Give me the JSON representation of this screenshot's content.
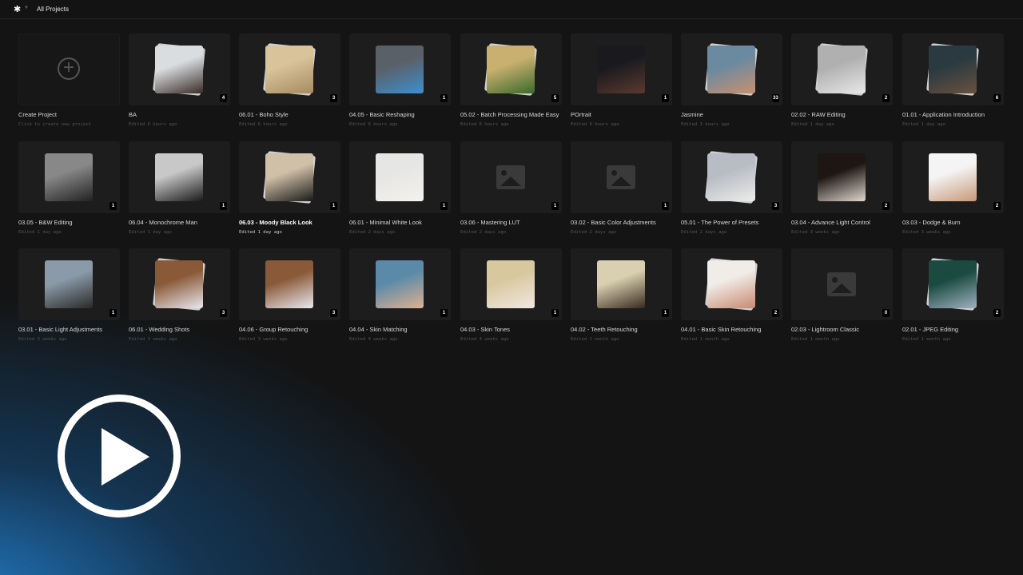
{
  "header": {
    "logo_icon": "sparkle-icon",
    "breadcrumb": "All Projects"
  },
  "create": {
    "title": "Create Project",
    "subtitle": "Click to create new project"
  },
  "projects": [
    {
      "title": "BA",
      "edited": "Edited 6 hours ago",
      "count": "4",
      "thumb": "stack",
      "colors": [
        "#d9dde0",
        "#3a2c28"
      ]
    },
    {
      "title": "06.01 - Boho Style",
      "edited": "Edited 6 hours ago",
      "count": "3",
      "thumb": "stack",
      "colors": [
        "#d8c39a",
        "#a78b60"
      ]
    },
    {
      "title": "04.05 - Basic Reshaping",
      "edited": "Edited 6 hours ago",
      "count": "1",
      "thumb": "photo",
      "colors": [
        "#5a6068",
        "#3d8fcf"
      ]
    },
    {
      "title": "05.02 - Batch Processing Made Easy",
      "edited": "Edited 6 hours ago",
      "count": "5",
      "thumb": "stack",
      "colors": [
        "#c9b070",
        "#3a6a2a"
      ]
    },
    {
      "title": "POrtrait",
      "edited": "Edited 6 hours ago",
      "count": "1",
      "thumb": "photo",
      "colors": [
        "#1a1a1e",
        "#5a3a30"
      ]
    },
    {
      "title": "Jasmine",
      "edited": "Edited 3 hours ago",
      "count": "33",
      "thumb": "stack",
      "colors": [
        "#6a8aa0",
        "#c89070"
      ]
    },
    {
      "title": "02.02 - RAW Editing",
      "edited": "Edited 1 day ago",
      "count": "2",
      "thumb": "stack",
      "colors": [
        "#b0b0b0",
        "#e8e8e8"
      ]
    },
    {
      "title": "01.01 - Application Introduction",
      "edited": "Edited 1 day ago",
      "count": "6",
      "thumb": "stack",
      "colors": [
        "#2a3a40",
        "#6a5040"
      ]
    },
    {
      "title": "03.05 - B&W Editing",
      "edited": "Edited 1 day ago",
      "count": "1",
      "thumb": "photo",
      "colors": [
        "#888",
        "#222"
      ]
    },
    {
      "title": "06.04 - Monochrome Man",
      "edited": "Edited 1 day ago",
      "count": "1",
      "thumb": "photo",
      "colors": [
        "#c8c8c8",
        "#1a1a1a"
      ]
    },
    {
      "title": "06.03 - Moody Black Look",
      "edited": "Edited 1 day ago",
      "count": "1",
      "thumb": "stack",
      "colors": [
        "#d0c0a8",
        "#1a1a1a"
      ],
      "highlight": true
    },
    {
      "title": "06.01 - Minimal White Look",
      "edited": "Edited 2 days ago",
      "count": "1",
      "thumb": "photo",
      "colors": [
        "#e6e6e4",
        "#f4f2ee"
      ]
    },
    {
      "title": "03.06 - Mastering LUT",
      "edited": "Edited 2 days ago",
      "count": "1",
      "thumb": "placeholder"
    },
    {
      "title": "03.02 - Basic Color Adjustments",
      "edited": "Edited 2 days ago",
      "count": "1",
      "thumb": "placeholder"
    },
    {
      "title": "05.01 - The Power of Presets",
      "edited": "Edited 2 days ago",
      "count": "3",
      "thumb": "stack",
      "colors": [
        "#b8bcc4",
        "#ececea"
      ]
    },
    {
      "title": "03.04 - Advance Light Control",
      "edited": "Edited 3 weeks ago",
      "count": "2",
      "thumb": "photo",
      "colors": [
        "#1e1612",
        "#e0d8d0"
      ]
    },
    {
      "title": "03.03 - Dodge & Burn",
      "edited": "Edited 3 weeks ago",
      "count": "2",
      "thumb": "photo",
      "colors": [
        "#f4f4f4",
        "#c89878"
      ]
    },
    {
      "title": "03.01 - Basic Light Adjustments",
      "edited": "Edited 3 weeks ago",
      "count": "1",
      "thumb": "photo",
      "colors": [
        "#8a9aa8",
        "#2a2a28"
      ]
    },
    {
      "title": "06.01 - Wedding Shots",
      "edited": "Edited 3 weeks ago",
      "count": "3",
      "thumb": "stack",
      "colors": [
        "#8a5a38",
        "#e8e8f0"
      ]
    },
    {
      "title": "04.06 - Group Retouching",
      "edited": "Edited 3 weeks ago",
      "count": "3",
      "thumb": "photo",
      "colors": [
        "#8a5a38",
        "#e8e8f0"
      ]
    },
    {
      "title": "04.04 - Skin Matching",
      "edited": "Edited 4 weeks ago",
      "count": "1",
      "thumb": "photo",
      "colors": [
        "#5a8aa8",
        "#e0b090"
      ]
    },
    {
      "title": "04.03 - Skin Tones",
      "edited": "Edited 4 weeks ago",
      "count": "1",
      "thumb": "photo",
      "colors": [
        "#d8c8a0",
        "#f0e8e0"
      ]
    },
    {
      "title": "04.02 - Teeth Retouching",
      "edited": "Edited 1 month ago",
      "count": "1",
      "thumb": "photo",
      "colors": [
        "#d8d0b0",
        "#3a2a20"
      ]
    },
    {
      "title": "04.01 - Basic Skin Retouching",
      "edited": "Edited 1 month ago",
      "count": "2",
      "thumb": "stack",
      "colors": [
        "#f0ece8",
        "#c88a70"
      ]
    },
    {
      "title": "02.03 - Lightroom Classic",
      "edited": "Edited 1 month ago",
      "count": "0",
      "thumb": "placeholder"
    },
    {
      "title": "02.01 - JPEG Editing",
      "edited": "Edited 1 month ago",
      "count": "2",
      "thumb": "stack",
      "colors": [
        "#1a4a40",
        "#a0b0c0"
      ]
    }
  ],
  "overlay": {
    "play_icon": "play-circle-icon"
  }
}
